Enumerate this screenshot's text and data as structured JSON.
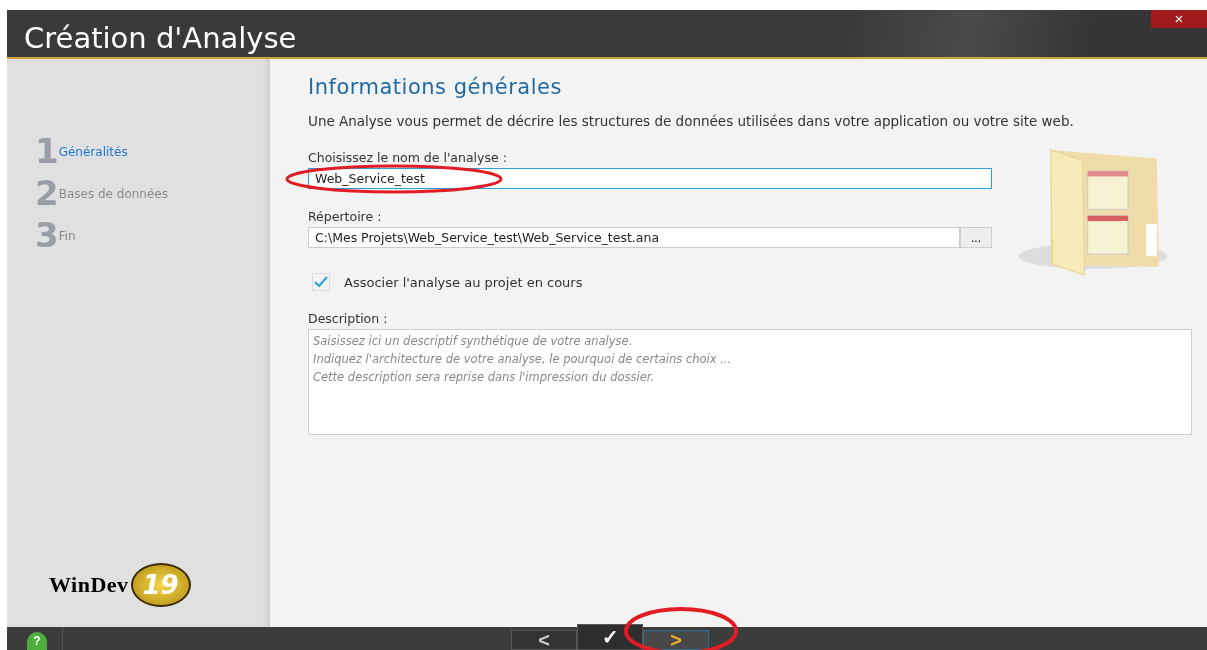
{
  "window": {
    "title": "Création d'Analyse",
    "close": "×"
  },
  "steps": [
    {
      "number": "1",
      "label": "Généralités",
      "selected": true
    },
    {
      "number": "2",
      "label": "Bases de données",
      "selected": false
    },
    {
      "number": "3",
      "label": "Fin",
      "selected": false
    }
  ],
  "logo": {
    "text": "WinDev",
    "version": "19"
  },
  "heading": "Informations générales",
  "intro": "Une Analyse vous permet de décrire les structures de données utilisées dans votre application ou votre site web.",
  "name_field": {
    "label": "Choisissez le nom de l'analyse :",
    "value": "Web_Service_test"
  },
  "directory_field": {
    "label": "Répertoire :",
    "value": "C:\\Mes Projets\\Web_Service_test\\Web_Service_test.ana",
    "browse": "..."
  },
  "associate": {
    "label": "Associer l'analyse au projet en cours",
    "checked": true
  },
  "description": {
    "label": "Description :",
    "placeholder": "Saisissez ici un descriptif synthétique de votre analyse.\nIndiquez l'architecture de votre analyse, le pourquoi de certains choix ...\nCette description sera reprise dans l'impression du dossier."
  },
  "bottom_bar": {
    "help": "?",
    "buttons": [
      {
        "label": "<",
        "kind": "back",
        "selected": false
      },
      {
        "label": "✓",
        "kind": "finish",
        "selected": false
      },
      {
        "label": ">",
        "kind": "next",
        "selected": true
      }
    ]
  }
}
